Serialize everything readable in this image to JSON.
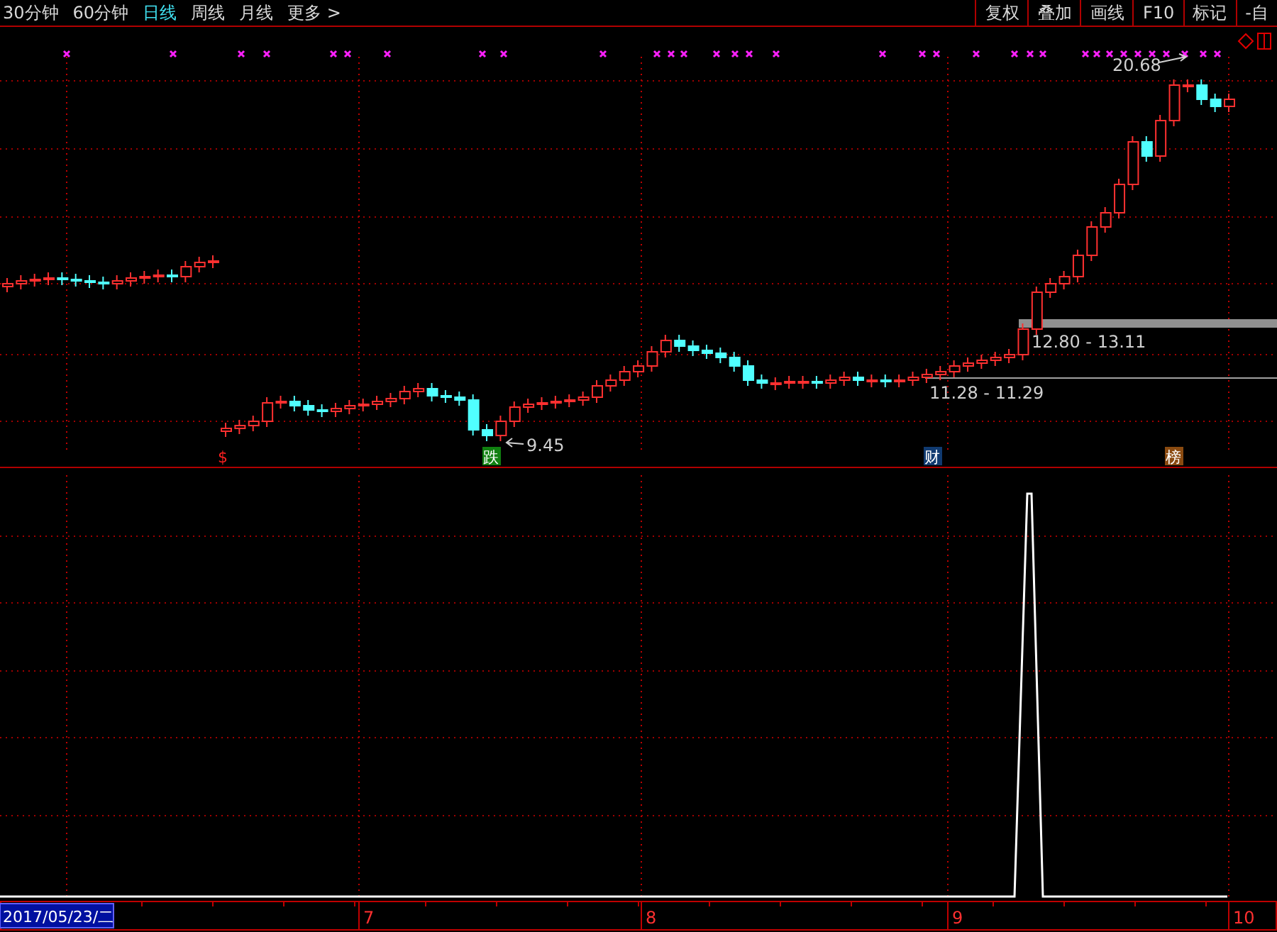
{
  "period_tabs": [
    {
      "label": "30分钟",
      "selected": false
    },
    {
      "label": "60分钟",
      "selected": false
    },
    {
      "label": "日线",
      "selected": true
    },
    {
      "label": "周线",
      "selected": false
    },
    {
      "label": "月线",
      "selected": false
    },
    {
      "label": "更多 >",
      "selected": false
    }
  ],
  "toolbar_buttons": [
    "复权",
    "叠加",
    "画线",
    "F10",
    "标记",
    "-自"
  ],
  "price_chart": {
    "high_label": "20.68",
    "low_label": "9.45",
    "ranges": [
      {
        "label": "12.80 - 13.11",
        "kind": "band"
      },
      {
        "label": "11.28 - 11.29",
        "kind": "line"
      }
    ],
    "events": [
      {
        "label": "$",
        "kind": "dividend"
      },
      {
        "label": "跌",
        "kind": "drop"
      },
      {
        "label": "财",
        "kind": "finance"
      },
      {
        "label": "榜",
        "kind": "ranking"
      }
    ]
  },
  "time_axis": {
    "cursor_date": "2017/05/23/二",
    "months": [
      "7",
      "8",
      "9",
      "10"
    ]
  }
}
